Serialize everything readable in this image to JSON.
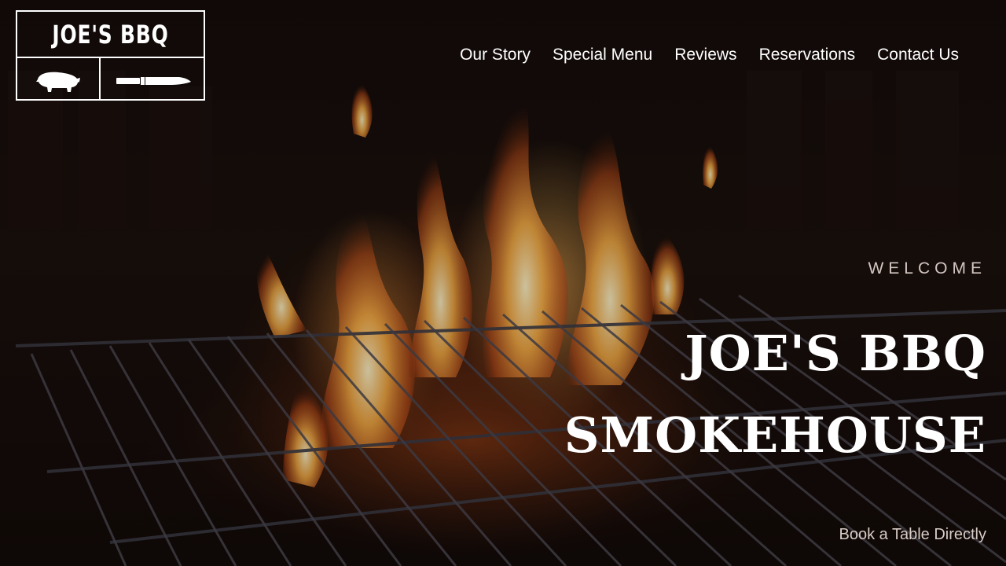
{
  "brand": {
    "logo_title": "JOE'S BBQ",
    "logo_icons": [
      "pig-icon",
      "knife-icon"
    ]
  },
  "nav": {
    "items": [
      {
        "label": "Our Story"
      },
      {
        "label": "Special Menu"
      },
      {
        "label": "Reviews"
      },
      {
        "label": "Reservations"
      },
      {
        "label": "Contact Us"
      }
    ]
  },
  "hero": {
    "eyebrow": "WELCOME",
    "title_line1": "JOE'S BBQ",
    "title_line2": "SMOKEHOUSE",
    "cta": "Book a Table Directly",
    "background": "grill-fire-photo"
  },
  "colors": {
    "text_primary": "#ffffff",
    "text_muted": "#d4c7c2",
    "flame": "#ff9a3c",
    "background": "#0b0706"
  }
}
